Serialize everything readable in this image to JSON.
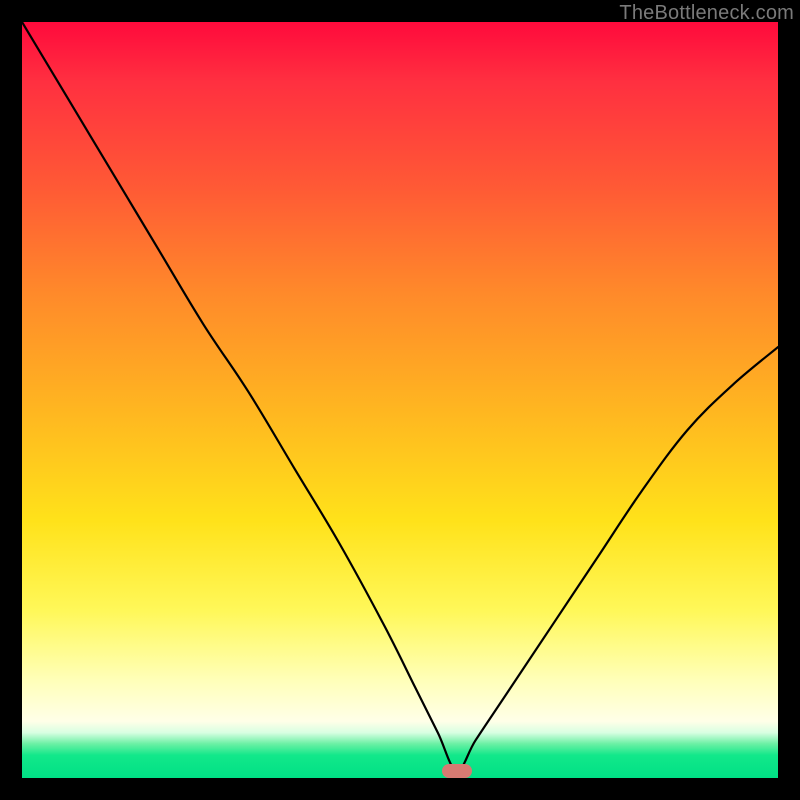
{
  "watermark": "TheBottleneck.com",
  "marker": {
    "x_pct": 57.5,
    "y_pct": 99.1
  },
  "chart_data": {
    "type": "line",
    "title": "",
    "xlabel": "",
    "ylabel": "",
    "xlim": [
      0,
      100
    ],
    "ylim": [
      0,
      100
    ],
    "grid": false,
    "legend": false,
    "series": [
      {
        "name": "bottleneck-curve",
        "x": [
          0,
          6,
          12,
          18,
          24,
          30,
          36,
          42,
          48,
          52,
          55,
          57.5,
          60,
          64,
          70,
          76,
          82,
          88,
          94,
          100
        ],
        "values": [
          100,
          90,
          80,
          70,
          60,
          51,
          41,
          31,
          20,
          12,
          6,
          1,
          5,
          11,
          20,
          29,
          38,
          46,
          52,
          57
        ]
      }
    ],
    "background_gradient": {
      "stops": [
        {
          "pos": 0.0,
          "color": "#ff0a3c"
        },
        {
          "pos": 0.22,
          "color": "#ff5a35"
        },
        {
          "pos": 0.52,
          "color": "#ffb820"
        },
        {
          "pos": 0.78,
          "color": "#fff85a"
        },
        {
          "pos": 0.93,
          "color": "#ffffe8"
        },
        {
          "pos": 0.97,
          "color": "#12e88a"
        },
        {
          "pos": 1.0,
          "color": "#00e085"
        }
      ]
    },
    "annotations": [
      {
        "type": "marker",
        "shape": "rounded-rect",
        "color": "#d77a72",
        "x": 57.5,
        "y": 1
      }
    ]
  }
}
